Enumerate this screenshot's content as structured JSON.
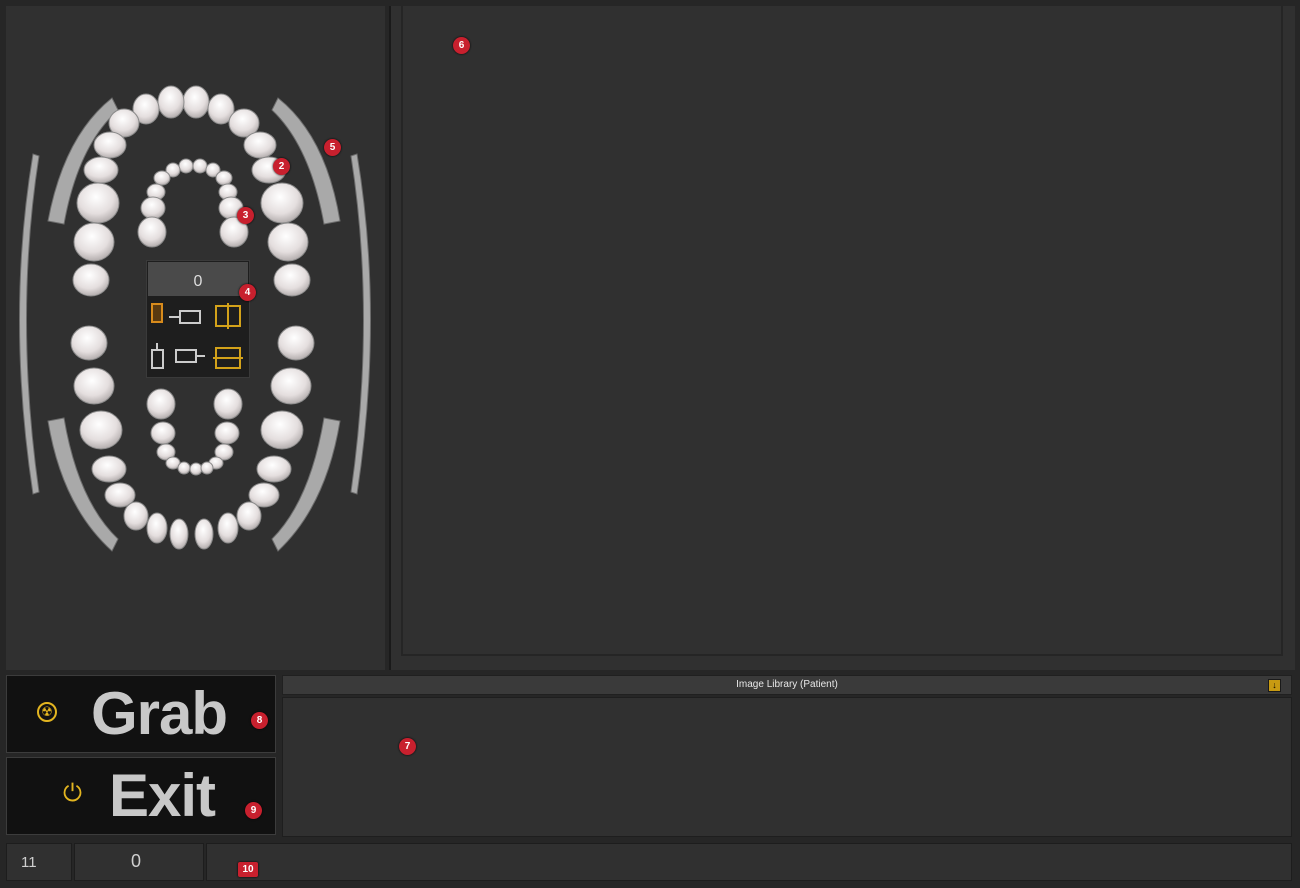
{
  "left_panel": {
    "counter_value": "0",
    "mode_icons": [
      "sensor-portrait-icon",
      "sensor-landscape-icon",
      "mirror-horizontal-icon",
      "sensor-rotate-portrait-icon",
      "sensor-rotate-landscape-icon",
      "mirror-vertical-icon"
    ]
  },
  "image_library": {
    "title": "Image Library (Patient)",
    "collapse_icon": "arrow-down-icon"
  },
  "buttons": {
    "grab": {
      "label": "Grab",
      "icon": "radiation-icon"
    },
    "exit": {
      "label": "Exit",
      "icon": "power-icon"
    }
  },
  "status_bar": {
    "cell1": "11",
    "cell2": "0",
    "cell3": ""
  },
  "annotations": {
    "n2": "2",
    "n3": "3",
    "n4": "4",
    "n5": "5",
    "n6": "6",
    "n7": "7",
    "n8": "8",
    "n9": "9",
    "n10": "10"
  },
  "colors": {
    "accent": "#e3b520",
    "badge": "#c8202e",
    "panel": "#303030",
    "background": "#262626"
  }
}
